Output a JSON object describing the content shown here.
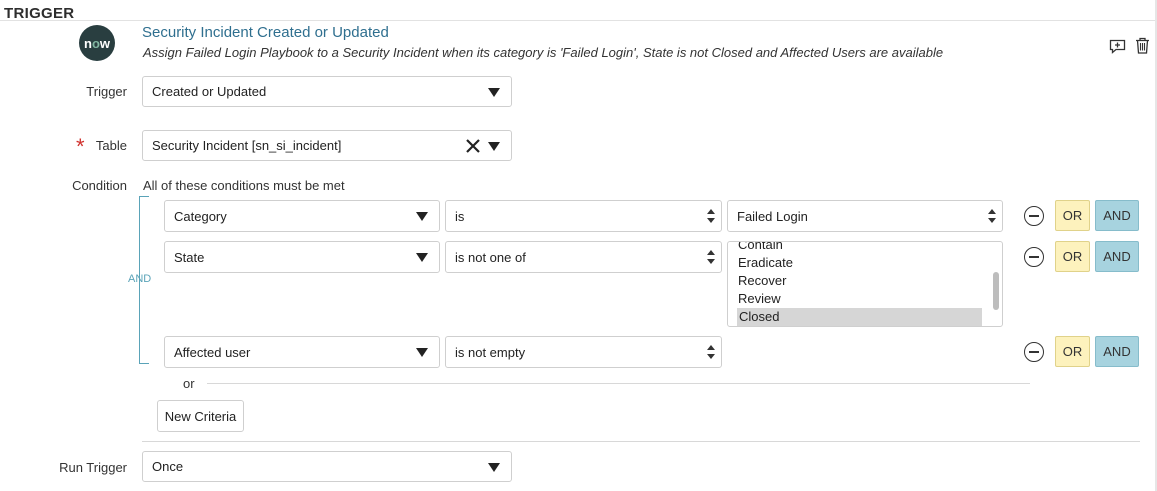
{
  "section": {
    "title": "TRIGGER"
  },
  "header": {
    "logo_text_n": "n",
    "logo_text_o": "o",
    "logo_text_w": "w",
    "title": "Security Incident Created or Updated",
    "description": "Assign Failed Login Playbook to a Security Incident when its category is 'Failed Login', State is not Closed and Affected Users are available",
    "icons": [
      "add-comment-icon",
      "trash-icon"
    ]
  },
  "trigger": {
    "label": "Trigger",
    "value": "Created or Updated"
  },
  "table": {
    "label": "Table",
    "value": "Security Incident [sn_si_incident]"
  },
  "condition": {
    "label": "Condition",
    "summary": "All of these conditions must be met",
    "group_operator": "AND",
    "rows": [
      {
        "field": "Category",
        "operator": "is",
        "value": "Failed Login"
      },
      {
        "field": "State",
        "operator": "is not one of",
        "options": [
          "Contain",
          "Eradicate",
          "Recover",
          "Review",
          "Closed"
        ],
        "selected": "Closed"
      },
      {
        "field": "Affected user",
        "operator": "is not empty"
      }
    ],
    "or_label": "OR",
    "and_label": "AND",
    "separator": "or",
    "new_criteria": "New Criteria"
  },
  "run_trigger": {
    "label": "Run Trigger",
    "value": "Once"
  },
  "colors": {
    "title": "#2f6f8f",
    "or_button": "#fdf2bd",
    "and_button": "#a7d3df",
    "required": "#d0312d",
    "logo_bg": "#293e40"
  }
}
